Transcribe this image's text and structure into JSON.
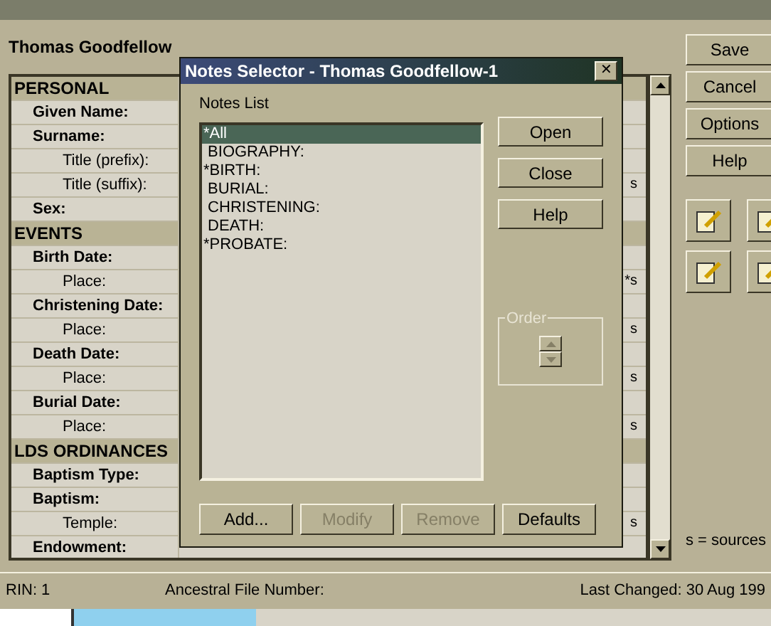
{
  "person_name": "Thomas Goodfellow",
  "fields": [
    {
      "kind": "section",
      "label": "PERSONAL"
    },
    {
      "kind": "label",
      "label": "Given Name:"
    },
    {
      "kind": "label",
      "label": "Surname:"
    },
    {
      "kind": "sub",
      "label": "Title (prefix):"
    },
    {
      "kind": "sub",
      "label": "Title (suffix):",
      "source": "s"
    },
    {
      "kind": "label",
      "label": "Sex:"
    },
    {
      "kind": "section",
      "label": "EVENTS"
    },
    {
      "kind": "label",
      "label": "Birth Date:"
    },
    {
      "kind": "sub",
      "label": "Place:",
      "source": "*s"
    },
    {
      "kind": "label",
      "label": "Christening Date:"
    },
    {
      "kind": "sub",
      "label": "Place:",
      "source": "s"
    },
    {
      "kind": "label",
      "label": "Death Date:"
    },
    {
      "kind": "sub",
      "label": "Place:",
      "source": "s"
    },
    {
      "kind": "label",
      "label": "Burial Date:"
    },
    {
      "kind": "sub",
      "label": "Place:",
      "source": "s"
    },
    {
      "kind": "section",
      "label": "LDS ORDINANCES"
    },
    {
      "kind": "label",
      "label": "Baptism Type:"
    },
    {
      "kind": "label",
      "label": "Baptism:"
    },
    {
      "kind": "sub",
      "label": "Temple:",
      "source": "s"
    },
    {
      "kind": "label",
      "label": "Endowment:"
    }
  ],
  "side_buttons": [
    "Save",
    "Cancel",
    "Options",
    "Help"
  ],
  "legend": "s = sources",
  "status_bar": {
    "rin": "RIN: 1",
    "afn": "Ancestral File Number:",
    "last_changed": "Last Changed: 30 Aug 199"
  },
  "dialog": {
    "title": "Notes Selector - Thomas Goodfellow-1",
    "close": "✕",
    "list_label": "Notes List",
    "notes": [
      {
        "label": "*All",
        "selected": true
      },
      {
        "label": " BIOGRAPHY:",
        "selected": false
      },
      {
        "label": "*BIRTH:",
        "selected": false
      },
      {
        "label": " BURIAL:",
        "selected": false
      },
      {
        "label": " CHRISTENING:",
        "selected": false
      },
      {
        "label": " DEATH:",
        "selected": false
      },
      {
        "label": "*PROBATE:",
        "selected": false
      }
    ],
    "side_buttons": [
      {
        "label": "Open",
        "disabled": false
      },
      {
        "label": "Close",
        "disabled": false
      },
      {
        "label": "Help",
        "disabled": false
      }
    ],
    "order_label": "Order",
    "bottom_buttons": [
      {
        "label": "Add...",
        "disabled": false
      },
      {
        "label": "Modify",
        "disabled": true
      },
      {
        "label": "Remove",
        "disabled": true
      },
      {
        "label": "Defaults",
        "disabled": false
      }
    ]
  }
}
